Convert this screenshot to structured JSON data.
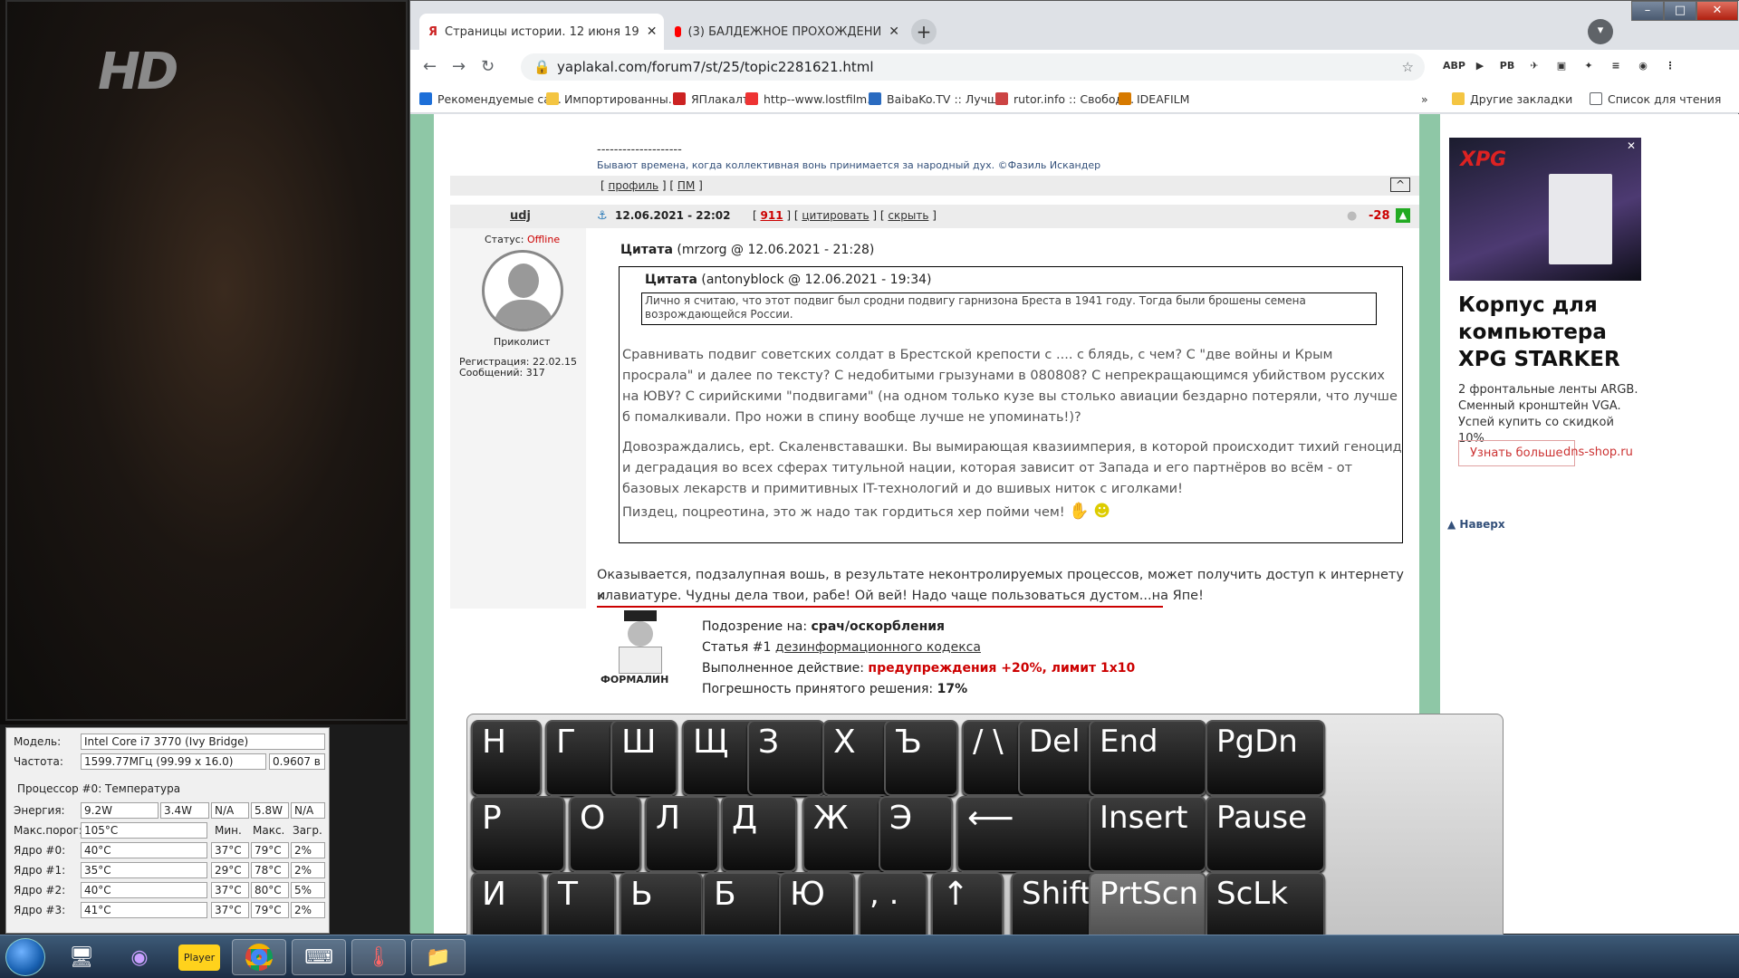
{
  "desktop": {
    "logo": "HD"
  },
  "cpu_monitor": {
    "model_label": "Модель:",
    "model_value": "Intel Core i7 3770 (Ivy Bridge)",
    "freq_label": "Частота:",
    "freq_value": "1599.77МГц (99.99 x 16.0)",
    "voltage": "0.9607 в",
    "section": "Процессор #0: Температура",
    "energy_label": "Энергия:",
    "energy": [
      "9.2W",
      "3.4W",
      "N/A",
      "5.8W",
      "N/A"
    ],
    "max_label": "Макс.порог:",
    "max_value": "105°C",
    "col_min": "Мин.",
    "col_max": "Макс.",
    "col_load": "Загр.",
    "cores": [
      {
        "name": "Ядро #0:",
        "cur": "40°C",
        "min": "37°C",
        "max": "79°C",
        "load": "2%"
      },
      {
        "name": "Ядро #1:",
        "cur": "35°C",
        "min": "29°C",
        "max": "78°C",
        "load": "2%"
      },
      {
        "name": "Ядро #2:",
        "cur": "40°C",
        "min": "37°C",
        "max": "80°C",
        "load": "5%"
      },
      {
        "name": "Ядро #3:",
        "cur": "41°C",
        "min": "37°C",
        "max": "79°C",
        "load": "2%"
      }
    ]
  },
  "browser": {
    "tabs": [
      {
        "title": "Страницы истории. 12 июня 19",
        "icon": "yaplakal-icon"
      },
      {
        "title": "(3) БАЛДЕЖНОЕ ПРОХОЖДЕНИ",
        "icon": "youtube-icon"
      }
    ],
    "new_tab": "+",
    "url": "yaplakal.com/forum7/st/25/topic2281621.html",
    "window_buttons": {
      "minimize": "–",
      "maximize": "□",
      "close": "✕"
    },
    "extensions": [
      "ABP",
      "▶",
      "PB",
      "✈",
      "▣",
      "✦",
      "≡",
      "◉",
      "⋮"
    ],
    "bookmarks": [
      {
        "label": "Рекомендуемые са...",
        "color": "#1d6fd8"
      },
      {
        "label": "Импортированны...",
        "color": "#f4c542"
      },
      {
        "label": "ЯПлакалъ",
        "color": "#c22"
      },
      {
        "label": "http--www.lostfilm....",
        "color": "#e33"
      },
      {
        "label": "BaibaKo.TV :: Лучш...",
        "color": "#2a6bc0"
      },
      {
        "label": "rutor.info :: Свобод...",
        "color": "#c44"
      },
      {
        "label": "IDEAFILM",
        "color": "#d77a00"
      }
    ],
    "bookmarks_more": "»",
    "other_bookmarks": "Другие закладки",
    "reading_list": "Список для чтения"
  },
  "forum": {
    "sig_dashes": "--------------------",
    "sig_text": "Бывают времена, когда коллективная вонь принимается за народный дух. ©Фазиль Искандер",
    "profile_link": "профиль",
    "pm_link": "ПМ",
    "up_btn": "^",
    "post": {
      "author": "udj",
      "date": "12.06.2021 - 22:02",
      "post_no": "911",
      "quote_link": "цитировать",
      "hide_link": "скрыть",
      "rating": "-28",
      "status_label": "Статус:",
      "status_value": "Offline",
      "rank": "Приколист",
      "reg": "Регистрация: 22.02.15",
      "msgs": "Сообщений: 317",
      "quote1_title": "Цитата",
      "quote1_meta": "(mrzorg @ 12.06.2021 - 21:28)",
      "quote2_title": "Цитата",
      "quote2_meta": "(antonyblock @ 12.06.2021 - 19:34)",
      "quote2_text": "Лично я считаю, что этот подвиг был сродни подвигу гарнизона Бреста в 1941 году. Тогда были брошены семена возрождающейся России.",
      "para1": "Сравнивать подвиг советских солдат в Брестской крепости с .... с блядь, с чем? С \"две войны и Крым просрала\" и далее по тексту? С недобитыми грызунами в 080808? С непрекращающимся убийством русских на ЮВУ? С сирийскими \"подвигами\" (на одном только кузе вы столько авиации бездарно потеряли, что лучше б помалкивали. Про ножи в спину вообще лучше не упоминать!)?",
      "para2": "Довозраждались, ept. Скаленвставашки. Вы вымирающая квазиимперия, в которой происходит тихий геноцид и деградация во всех сферах титульной нации, которая зависит от Запада и его партнёров во всём - от базовых лекарств и примитивных IT-технологий и до вшивых ниток с иголками!",
      "para3": "Пиздец, поцреотина, это ж надо так гордиться хер пойми чем!",
      "reply1": "Оказывается, подзалупная вошь, в результате неконтролируемых процессов, может получить доступ к интернету и",
      "reply2": "клавиатуре. Чудны дела твои, рабе! Ой вей! Надо чаще пользоваться дустом...на Япе!",
      "formalin": "ФОРМАЛИН",
      "susp_label": "Подозрение на:",
      "susp_value": "срач/оскорбления",
      "article_label": "Статья #1",
      "article_value": "дезинформационного кодекса",
      "action_label": "Выполненное действие:",
      "action_value": "предупреждения +20%, лимит 1x10",
      "error_label": "Погрешность принятого решения:",
      "error_value": "17%"
    }
  },
  "ad": {
    "brand": "XPG",
    "title": "Корпус для компьютера XPG STARKER",
    "desc": "2 фронтальные ленты ARGB. Сменный кронштейн VGA. Успей купить со скидкой 10%",
    "cta": "Узнать больше",
    "domain": "dns-shop.ru",
    "top_link": "Наверх"
  },
  "keyboard": {
    "row1": [
      "Н",
      "Г",
      "Ш",
      "Щ",
      "З",
      "Х",
      "Ъ",
      "/ \\",
      "Del",
      "End",
      "PgDn"
    ],
    "row2": [
      "Р",
      "О",
      "Л",
      "Д",
      "Ж",
      "Э",
      "⟵",
      "Insert",
      "Pause"
    ],
    "row3": [
      "И",
      "Т",
      "Ь",
      "Б",
      "Ю",
      ", .",
      "↑",
      "Shift",
      "PrtScn",
      "ScLk"
    ]
  },
  "taskbar": {
    "apps": [
      "windows-explorer",
      "tor-browser",
      "kmplayer",
      "chrome",
      "keyboard",
      "cpu-monitor",
      "folder"
    ],
    "player_label": "Player"
  }
}
